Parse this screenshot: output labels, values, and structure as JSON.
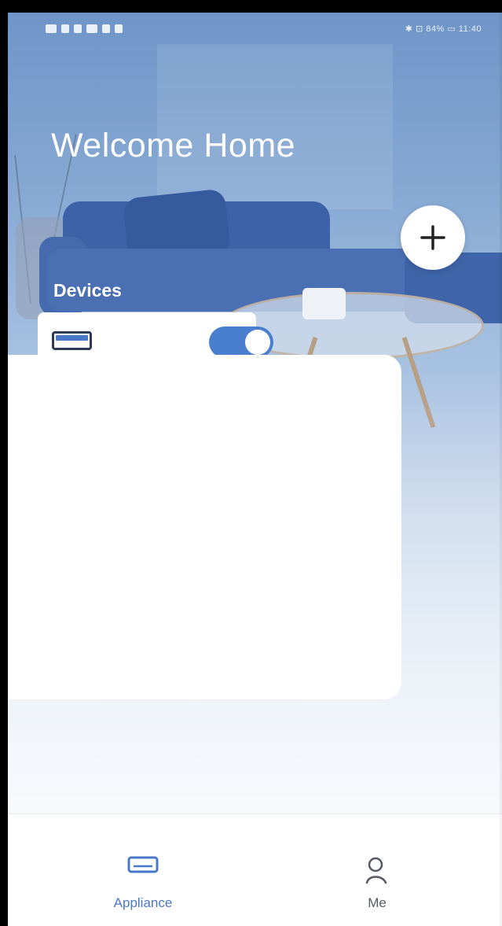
{
  "status_bar": {
    "left_icons": [
      "notification-icon",
      "signal-icon",
      "wifi-icon",
      "nfc-icon",
      "screenshot-icon",
      "usb-icon"
    ],
    "right_text": "✱ ⊡ 84% ▭ 11:40"
  },
  "header": {
    "title": "Welcome Home",
    "add_icon": "plus-icon"
  },
  "devices": {
    "section_title": "Devices",
    "items": [
      {
        "icon": "air-conditioner-icon",
        "power_on": true,
        "accent_color": "#4a7fd0"
      }
    ]
  },
  "bottom_nav": {
    "items": [
      {
        "label": "Appliance",
        "icon": "air-conditioner-icon",
        "active": true
      },
      {
        "label": "Me",
        "icon": "person-icon",
        "active": false
      }
    ],
    "active_color": "#4a78c8",
    "inactive_color": "#555a63"
  }
}
